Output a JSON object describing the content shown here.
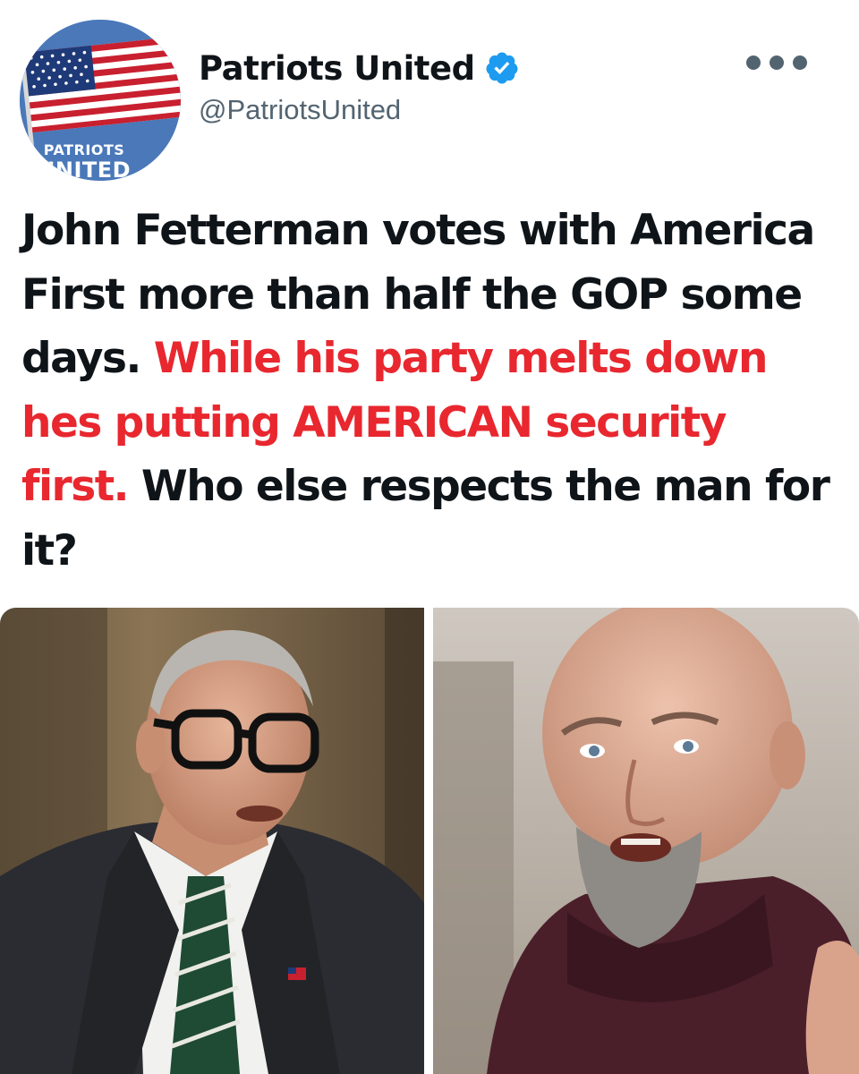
{
  "account": {
    "display_name": "Patriots United",
    "handle": "@PatriotsUnited",
    "verified": true,
    "avatar_line1": "PATRIOTS",
    "avatar_line2": "UNITED"
  },
  "more_menu_icon": "more-horizontal-icon",
  "tweet": {
    "part1": "John Fetterman votes with America First more than half the GOP some days. ",
    "part2_highlight": "While his party melts down hes putting AMERICAN security first.",
    "part3": " Who else respects the man for it?"
  },
  "media": {
    "photos": [
      "left-photo",
      "right-photo"
    ]
  },
  "colors": {
    "highlight_red": "#e8272f",
    "verified_blue": "#1d9bf0",
    "handle_gray": "#536471",
    "text": "#0f1419"
  }
}
